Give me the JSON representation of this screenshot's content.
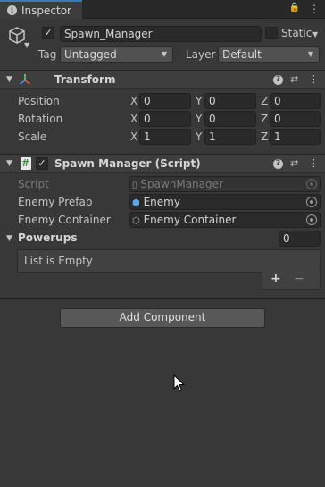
{
  "tab": {
    "title": "Inspector",
    "icon": "info-icon"
  },
  "tab_icons": {
    "lock": "🔒",
    "menu": "⋮"
  },
  "gameobject": {
    "name": "Spawn_Manager",
    "active": "✓",
    "static_label": "Static",
    "tag_label": "Tag",
    "tag_value": "Untagged",
    "layer_label": "Layer",
    "layer_value": "Default"
  },
  "transform": {
    "title": "Transform",
    "rows": [
      {
        "label": "Position",
        "x": "0",
        "y": "0",
        "z": "0"
      },
      {
        "label": "Rotation",
        "x": "0",
        "y": "0",
        "z": "0"
      },
      {
        "label": "Scale",
        "x": "1",
        "y": "1",
        "z": "1"
      }
    ],
    "axis_x": "X",
    "axis_y": "Y",
    "axis_z": "Z"
  },
  "script_component": {
    "title": "Spawn Manager (Script)",
    "enabled": "✓",
    "fields": [
      {
        "label": "Script",
        "value": "SpawnManager"
      },
      {
        "label": "Enemy Prefab",
        "value": "Enemy"
      },
      {
        "label": "Enemy Container",
        "value": "Enemy Container"
      }
    ],
    "powerups_label": "Powerups",
    "powerups_count": "0",
    "list_empty": "List is Empty",
    "add": "+",
    "remove": "−"
  },
  "header_icons": {
    "help": "?",
    "settings": "⇄",
    "more": "⋮"
  },
  "add_component": "Add Component",
  "colors": {
    "background": "#383838",
    "tab_accent": "#3a79bb",
    "field": "#2a2a2a"
  }
}
